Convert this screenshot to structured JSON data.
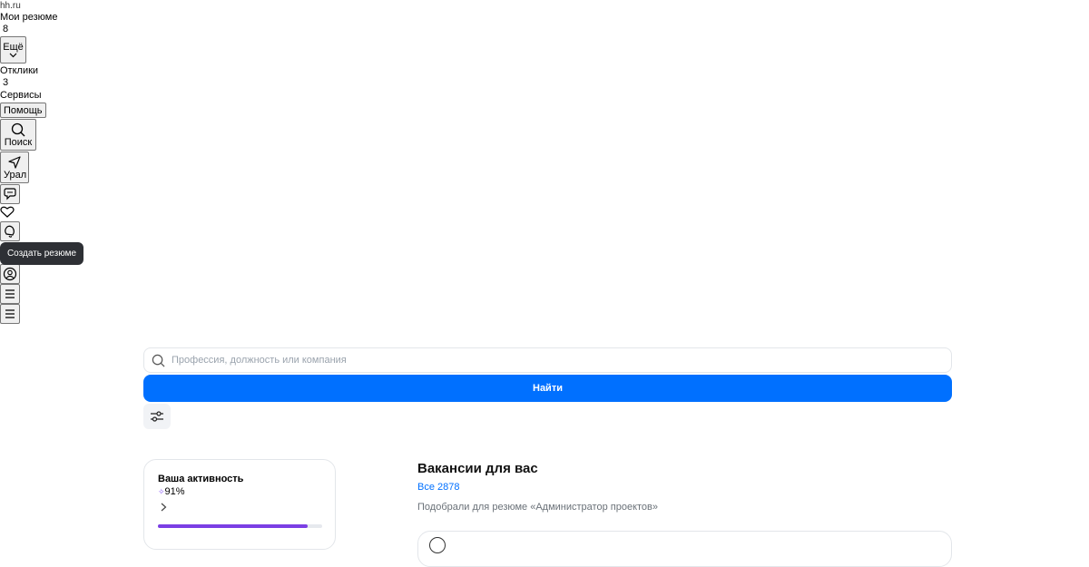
{
  "header": {
    "logo": "hh.ru",
    "my_resumes": {
      "label": "Мои резюме",
      "count": "8"
    },
    "more_button": "Ещё",
    "responses": {
      "label": "Отклики",
      "count": "3"
    },
    "services": "Сервисы",
    "help_button": "Помощь",
    "search_button": "Поиск",
    "region_button": "Урал"
  },
  "tooltip": {
    "text": "Создать резюме"
  },
  "search": {
    "placeholder": "Профессия, должность или компания",
    "submit_label": "Найти"
  },
  "activity": {
    "title": "Ваша активность",
    "percent": "91%",
    "progress": 0.91,
    "colors": {
      "bar_fill": "#7b3fe4",
      "bar_track": "#e6e9ee"
    }
  },
  "vacancies": {
    "title": "Вакансии для вас",
    "all_link": "Все 2878",
    "subtitle": "Подобрали для резюме «Администратор проектов»"
  },
  "icons": [
    "search-icon",
    "chevron-down-icon",
    "location-arrow-icon",
    "chat-icon",
    "heart-icon",
    "bell-icon",
    "user-icon",
    "menu-icon",
    "filter-icon",
    "chevron-right-icon"
  ],
  "colors": {
    "accent": "#0070ff",
    "tooltip_bg": "#2e3035"
  }
}
